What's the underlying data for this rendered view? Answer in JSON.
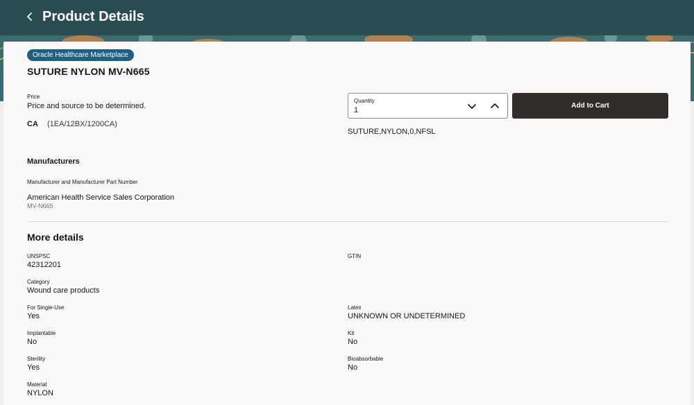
{
  "header": {
    "title": "Product Details",
    "back_icon": "chevron-left-icon"
  },
  "product": {
    "badge": "Oracle Healthcare Marketplace",
    "name": "SUTURE NYLON MV-N665"
  },
  "pricing": {
    "price_label": "Price",
    "price_value": "Price and source to be determined.",
    "uom": "CA",
    "pack": "(1EA/12BX/1200CA)"
  },
  "quantity": {
    "label": "Quantity",
    "value": "1",
    "decrease_icon": "chevron-down-icon",
    "increase_icon": "chevron-up-icon"
  },
  "add_to_cart_label": "Add to Cart",
  "description": "SUTURE,NYLON,0,NFSL",
  "manufacturers": {
    "title": "Manufacturers",
    "column_label": "Manufacturer and Manufacturer Part Number",
    "name": "American Health Service Sales Corporation",
    "part_number": "MV-N665"
  },
  "more_details": {
    "title": "More details",
    "unspsc_label": "UNSPSC",
    "unspsc_value": "42312201",
    "gtin_label": "GTIN",
    "category_label": "Category",
    "category_value": "Wound care products",
    "single_use_label": "For Single-Use",
    "single_use_value": "Yes",
    "latex_label": "Latex",
    "latex_value": "UNKNOWN OR UNDETERMINED",
    "implantable_label": "Implantable",
    "implantable_value": "No",
    "kit_label": "Kit",
    "kit_value": "No",
    "sterility_label": "Sterility",
    "sterility_value": "Yes",
    "bioabsorbable_label": "Bioabsorbable",
    "bioabsorbable_value": "No",
    "material_label": "Material",
    "material_value": "NYLON"
  },
  "colors": {
    "header_bg": "#2b4d52",
    "badge_bg": "#1e5f82",
    "button_bg": "#312d2a"
  }
}
